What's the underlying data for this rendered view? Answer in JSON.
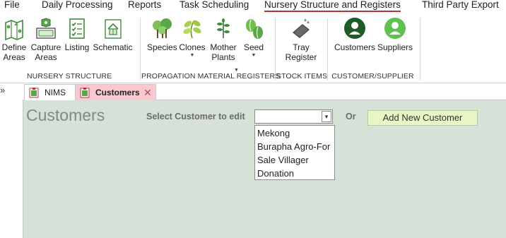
{
  "menu": {
    "file": "File",
    "daily": "Daily Processing",
    "reports": "Reports",
    "tasks": "Task Scheduling",
    "nursery": "Nursery Structure and Registers",
    "third_party": "Third Party Export"
  },
  "ribbon": {
    "nursery_structure": {
      "label": "NURSERY STRUCTURE",
      "define_areas_1": "Define",
      "define_areas_2": "Areas",
      "capture_areas_1": "Capture",
      "capture_areas_2": "Areas",
      "listing": "Listing",
      "schematic": "Schematic"
    },
    "propagation": {
      "label": "PROPAGATION MATERIAL REGISTERS",
      "species": "Species",
      "clones": "Clones",
      "mother_plants_1": "Mother",
      "mother_plants_2": "Plants",
      "seed": "Seed"
    },
    "stock": {
      "label": "STOCK ITEMS",
      "tray_register_1": "Tray",
      "tray_register_2": "Register"
    },
    "customer_supplier": {
      "label": "CUSTOMER/SUPPLIER",
      "customers": "Customers",
      "suppliers": "Suppliers"
    }
  },
  "nav": {
    "toggle_glyph": "»"
  },
  "tabs": {
    "nims": "NIMS",
    "customers": "Customers",
    "close_glyph": "✕"
  },
  "form": {
    "title": "Customers",
    "select_label": "Select Customer to edit",
    "selected_value": "",
    "or_label": "Or",
    "add_button": "Add New Customer",
    "dropdown_arrow": "▾",
    "options": [
      "Mekong",
      "Burapha Agro-For",
      "Sale Villager",
      "Donation"
    ]
  },
  "colors": {
    "active_menu_underline": "#b03a3a",
    "form_background": "#d6e2d7",
    "active_tab": "#f9c8d0",
    "add_button": "#e9f5c4",
    "icon_green": "#3c8a3c"
  }
}
